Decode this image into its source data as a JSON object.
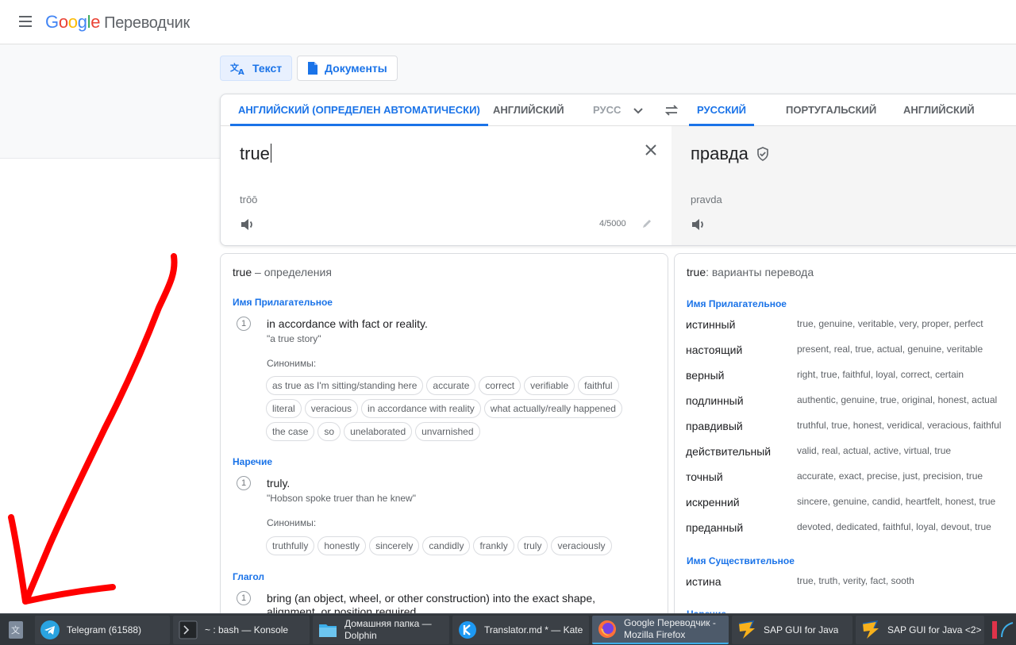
{
  "header": {
    "logo_google": "Google",
    "app_name": "Переводчик"
  },
  "modes": {
    "text_label": "Текст",
    "docs_label": "Документы"
  },
  "source_langs": [
    {
      "label": "АНГЛИЙСКИЙ (ОПРЕДЕЛЕН АВТОМАТИЧЕСКИ)"
    },
    {
      "label": "АНГЛИЙСКИЙ"
    },
    {
      "label": "РУСС"
    }
  ],
  "target_langs": [
    {
      "label": "РУССКИЙ"
    },
    {
      "label": "ПОРТУГАЛЬСКИЙ"
    },
    {
      "label": "АНГЛИЙСКИЙ"
    }
  ],
  "source": {
    "text": "true",
    "transliteration": "trōō",
    "char_count": "4/5000"
  },
  "target": {
    "text": "правда",
    "transliteration": "pravda"
  },
  "definitions": {
    "word": "true",
    "title_suffix": " – определения",
    "synonyms_label": "Синонимы:",
    "groups": [
      {
        "pos": "Имя Прилагательное",
        "num": "1",
        "gloss": "in accordance with fact or reality.",
        "example": "\"a true story\"",
        "synonyms": [
          "as true as I'm sitting/standing here",
          "accurate",
          "correct",
          "verifiable",
          "faithful",
          "literal",
          "veracious",
          "in accordance with reality",
          "what actually/really happened",
          "the case",
          "so",
          "unelaborated",
          "unvarnished"
        ]
      },
      {
        "pos": "Наречие",
        "num": "1",
        "gloss": "truly.",
        "example": "\"Hobson spoke truer than he knew\"",
        "synonyms": [
          "truthfully",
          "honestly",
          "sincerely",
          "candidly",
          "frankly",
          "truly",
          "veraciously"
        ]
      },
      {
        "pos": "Глагол",
        "num": "1",
        "gloss": "bring (an object, wheel, or other construction) into the exact shape,",
        "gloss2": "alignment, or position required."
      }
    ]
  },
  "variants": {
    "word": "true",
    "title_suffix": ": варианты перевода",
    "adj_label": "Имя Прилагательное",
    "adj": [
      {
        "word": "истинный",
        "back": "true, genuine, veritable, very, proper, perfect"
      },
      {
        "word": "настоящий",
        "back": "present, real, true, actual, genuine, veritable"
      },
      {
        "word": "верный",
        "back": "right, true, faithful, loyal, correct, certain"
      },
      {
        "word": "подлинный",
        "back": "authentic, genuine, true, original, honest, actual"
      },
      {
        "word": "правдивый",
        "back": "truthful, true, honest, veridical, veracious, faithful"
      },
      {
        "word": "действительный",
        "back": "valid, real, actual, active, virtual, true"
      },
      {
        "word": "точный",
        "back": "accurate, exact, precise, just, precision, true"
      },
      {
        "word": "искренний",
        "back": "sincere, genuine, candid, heartfelt, honest, true"
      },
      {
        "word": "преданный",
        "back": "devoted, dedicated, faithful, loyal, devout, true"
      }
    ],
    "noun_label": "Имя Существительное",
    "noun": [
      {
        "word": "истина",
        "back": "true, truth, verity, fact, sooth"
      }
    ],
    "next_label": "Наречие"
  },
  "taskbar": {
    "tasks": [
      {
        "label": "Telegram (61588)",
        "icon": "telegram-icon"
      },
      {
        "label": "~ : bash — Konsole",
        "icon": "terminal-icon"
      },
      {
        "label": "Домашняя папка —",
        "label2": "Dolphin",
        "icon": "folder-icon"
      },
      {
        "label": "Translator.md * — Kate",
        "icon": "kate-icon"
      },
      {
        "label": "Google Переводчик -",
        "label2": "Mozilla Firefox",
        "icon": "firefox-icon"
      },
      {
        "label": "SAP GUI for Java",
        "icon": "sap-icon"
      },
      {
        "label": "SAP GUI for Java <2>",
        "icon": "sap-icon"
      }
    ]
  },
  "colors": {
    "accent": "#1a73e8",
    "annotation": "#ff0000",
    "taskbar": "#31363b"
  }
}
